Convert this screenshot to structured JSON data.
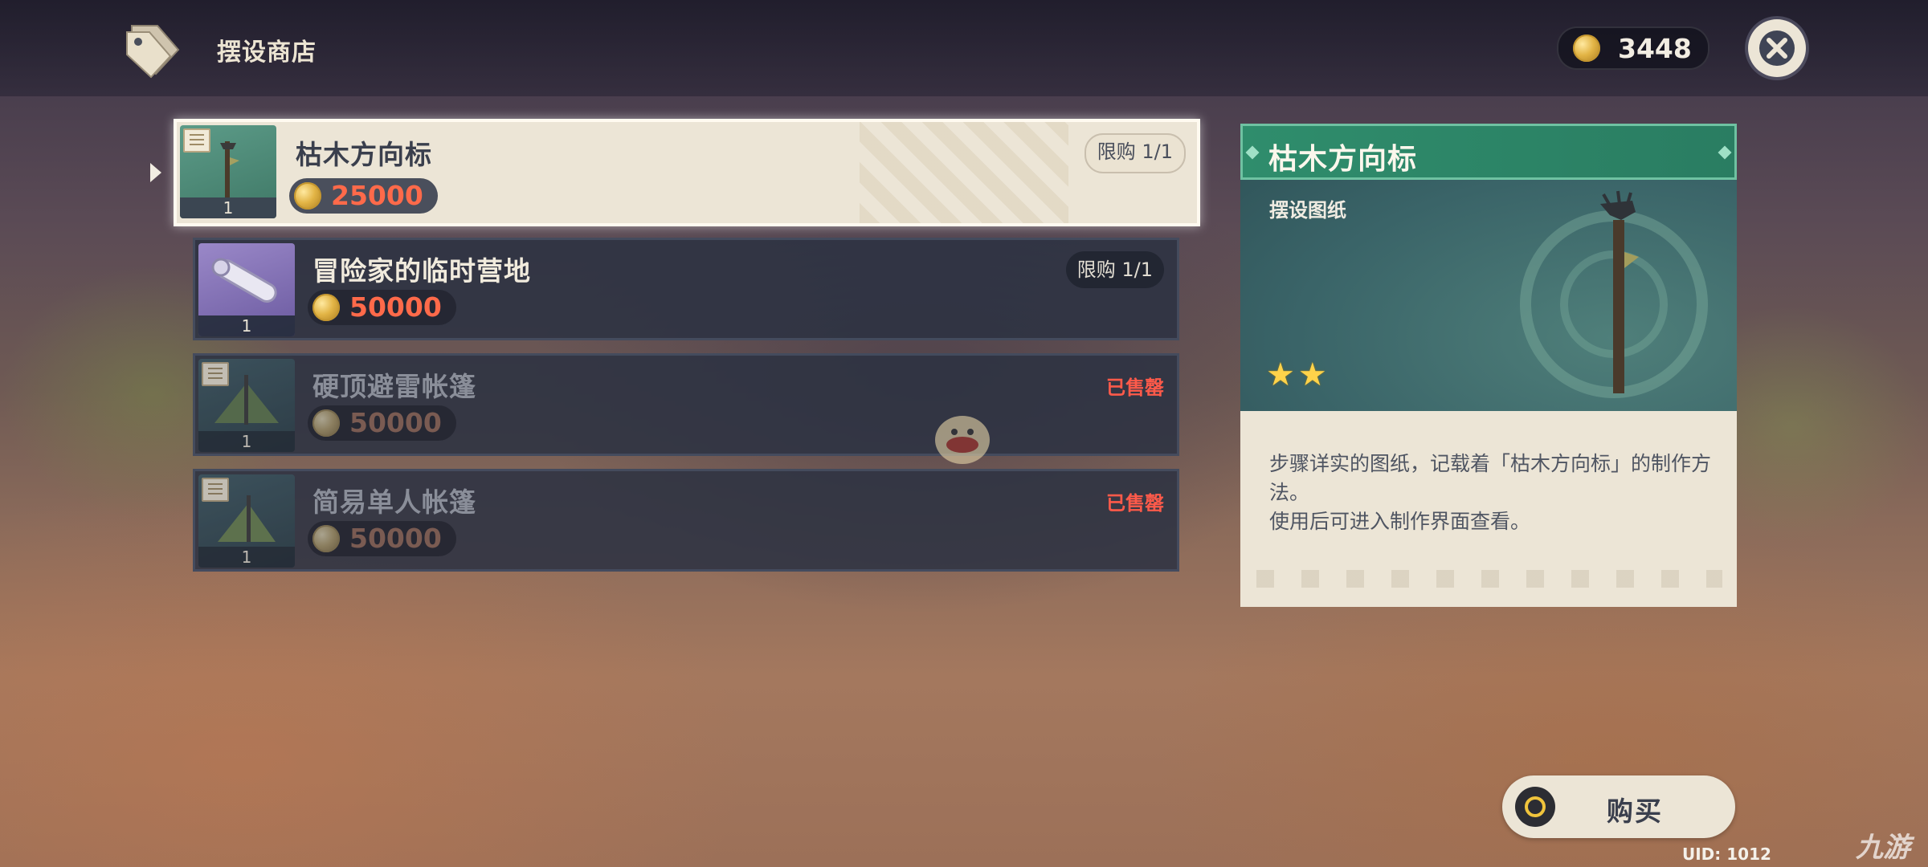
{
  "header": {
    "shop_title": "摆设商店",
    "currency_amount": "3448"
  },
  "items": [
    {
      "name": "枯木方向标",
      "price": "25000",
      "count": "1",
      "limit": "限购 1/1",
      "status": "",
      "selected": true
    },
    {
      "name": "冒险家的临时营地",
      "price": "50000",
      "count": "1",
      "limit": "限购 1/1",
      "status": ""
    },
    {
      "name": "硬顶避雷帐篷",
      "price": "50000",
      "count": "1",
      "limit": "",
      "status": "已售罄"
    },
    {
      "name": "简易单人帐篷",
      "price": "50000",
      "count": "1",
      "limit": "",
      "status": "已售罄"
    }
  ],
  "detail": {
    "title": "枯木方向标",
    "type": "摆设图纸",
    "rarity": 2,
    "description_1": "步骤详实的图纸，记载着「枯木方向标」的制作方法。",
    "description_2": "使用后可进入制作界面查看。"
  },
  "buy_button": {
    "label": "购买"
  },
  "footer": {
    "uid": "UID: 1012",
    "watermark": "九游"
  },
  "colors": {
    "accent_green": "#2f8d6c",
    "price_red": "#ff6a4a",
    "sold_red": "#ff5a4a",
    "panel_cream": "#ece5d6"
  }
}
